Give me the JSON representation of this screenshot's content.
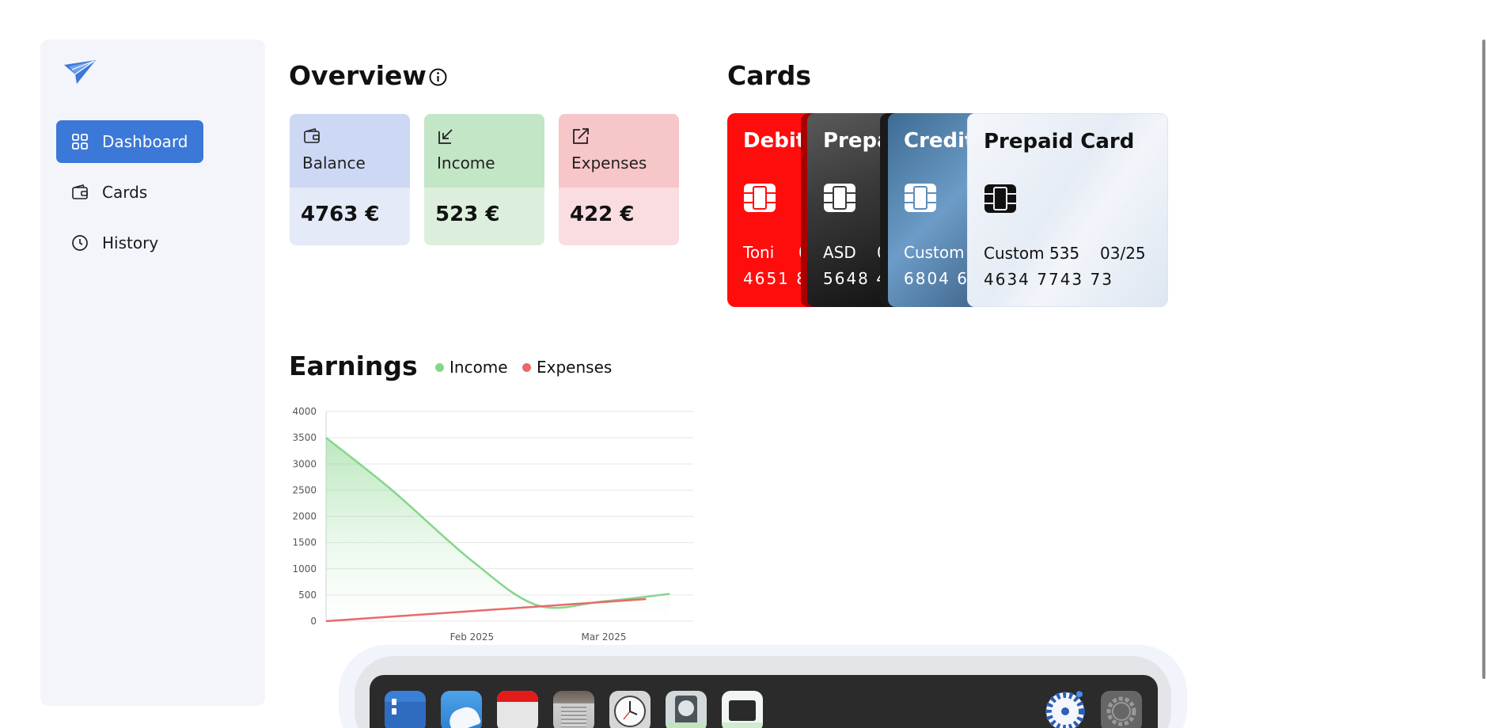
{
  "sidebar": {
    "items": [
      {
        "label": "Dashboard",
        "icon": "grid-icon",
        "active": true
      },
      {
        "label": "Cards",
        "icon": "wallet-icon",
        "active": false
      },
      {
        "label": "History",
        "icon": "clock-icon",
        "active": false
      }
    ]
  },
  "overview": {
    "title": "Overview",
    "tiles": [
      {
        "label": "Balance",
        "value": "4763 €",
        "icon": "wallet-icon",
        "top_color": "#cdd8f4",
        "bottom_color": "#e4eaf7"
      },
      {
        "label": "Income",
        "value": "523 €",
        "icon": "arrow-down-left-icon",
        "top_color": "#c2e6c6",
        "bottom_color": "#dcefdd"
      },
      {
        "label": "Expenses",
        "value": "422 €",
        "icon": "arrow-up-right-icon",
        "top_color": "#f7c6c9",
        "bottom_color": "#f9dde1"
      }
    ]
  },
  "cards": {
    "title": "Cards",
    "items": [
      {
        "title": "Debit C",
        "holder": "Toni",
        "expiry": "0",
        "number": "4651 81",
        "color": "#ff0d0d",
        "text_color": "#ffffff"
      },
      {
        "title": "Prepai",
        "holder": "ASD",
        "expiry": "0",
        "number": "5648 4",
        "color": "#3a3a3a",
        "text_color": "#ffffff"
      },
      {
        "title": "Credit",
        "holder": "Custom",
        "expiry": "",
        "number": "6804 6",
        "color": "#5f8fb8",
        "text_color": "#ffffff"
      },
      {
        "title": "Prepaid Card",
        "holder": "Custom 535",
        "expiry": "03/25",
        "number": "4634 7743 73",
        "color": "#edf1f7",
        "text_color": "#111111"
      }
    ]
  },
  "earnings": {
    "title": "Earnings",
    "legend": [
      {
        "label": "Income",
        "color": "#86d68c"
      },
      {
        "label": "Expenses",
        "color": "#e86a6a"
      }
    ]
  },
  "chart_data": {
    "type": "line",
    "x_ticks": [
      "Feb 2025",
      "Mar 2025"
    ],
    "y_ticks": [
      "0",
      "500",
      "1000",
      "1500",
      "2000",
      "2500",
      "3000",
      "3500",
      "4000"
    ],
    "ylim": [
      0,
      4000
    ],
    "grid": true,
    "series": [
      {
        "name": "Income",
        "color": "#86d68c",
        "fill": true,
        "points": [
          {
            "x": "2025-01-01",
            "y": 3500
          },
          {
            "x": "2025-01-15",
            "y": 2500
          },
          {
            "x": "2025-02-01",
            "y": 1150
          },
          {
            "x": "2025-02-15",
            "y": 300
          },
          {
            "x": "2025-03-01",
            "y": 380
          },
          {
            "x": "2025-03-15",
            "y": 520
          }
        ]
      },
      {
        "name": "Expenses",
        "color": "#e86a6a",
        "fill": false,
        "points": [
          {
            "x": "2025-01-01",
            "y": 0
          },
          {
            "x": "2025-03-10",
            "y": 422
          }
        ]
      }
    ]
  },
  "dock": {
    "apps": [
      {
        "name": "files-app-icon",
        "color": "#3a80d6"
      },
      {
        "name": "weather-app-icon",
        "color": "#4a9be0"
      },
      {
        "name": "calendar-app-icon",
        "color": "#e8e8e8"
      },
      {
        "name": "archive-app-icon",
        "color": "#8a8078"
      },
      {
        "name": "clock-app-icon",
        "color": "#d8d8d8"
      },
      {
        "name": "disk-app-icon",
        "color": "#cfd6d8"
      },
      {
        "name": "terminal-app-icon",
        "color": "#eef3ee"
      },
      {
        "name": "launcher-app-icon",
        "color": "#3a6fc8"
      },
      {
        "name": "settings-app-icon",
        "color": "#6a6a6a"
      }
    ]
  }
}
